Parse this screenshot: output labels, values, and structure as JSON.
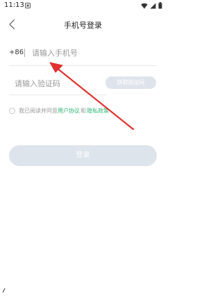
{
  "status_bar": {
    "time": "11:13"
  },
  "header": {
    "title": "手机号登录"
  },
  "phone": {
    "country_code": "+86",
    "placeholder": "请输入手机号",
    "value": ""
  },
  "code": {
    "placeholder": "请输入验证码",
    "value": "",
    "get_code_label": "获取验证码"
  },
  "agreement": {
    "prefix": "我已阅读并同意",
    "user_agreement": "用户协议",
    "and": "和",
    "privacy_policy": "隐私政策",
    "checked": false
  },
  "login": {
    "label": "登录"
  },
  "colors": {
    "accent_green": "#2bb673",
    "disabled_button": "#dde4ec",
    "annotation_arrow": "#e0302f"
  }
}
